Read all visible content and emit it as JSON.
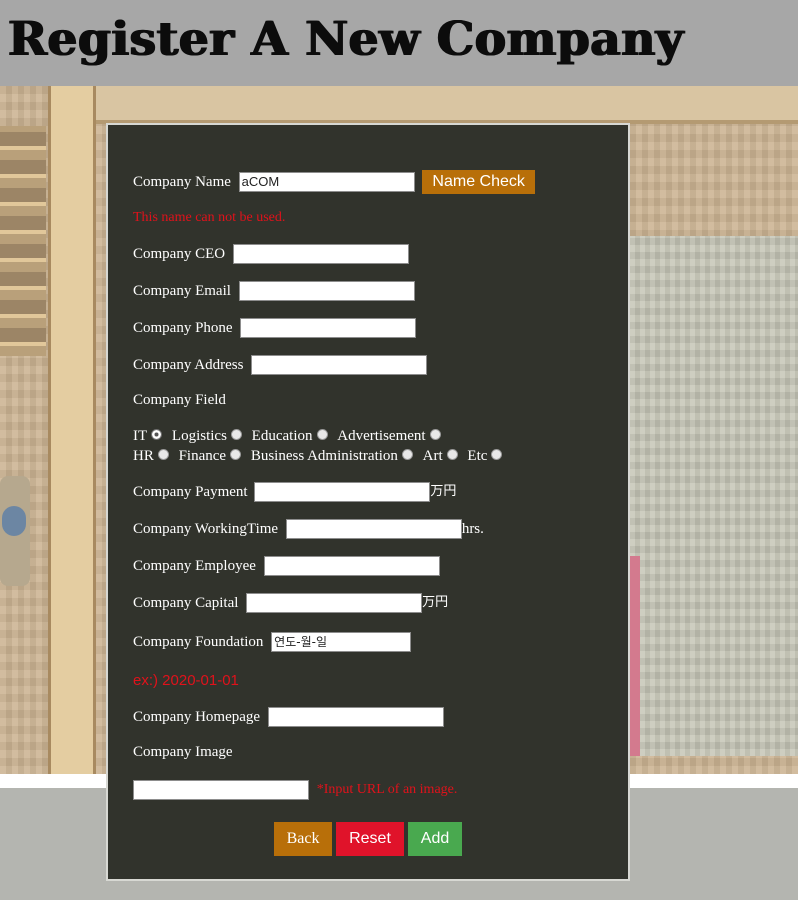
{
  "header": {
    "title": "Register A New Company"
  },
  "form": {
    "company_name": {
      "label": "Company Name",
      "value": "aCOM",
      "check_button": "Name Check"
    },
    "name_error": "This name can not be used.",
    "ceo": {
      "label": "Company CEO",
      "value": ""
    },
    "email": {
      "label": "Company Email",
      "value": ""
    },
    "phone": {
      "label": "Company Phone",
      "value": ""
    },
    "address": {
      "label": "Company Address",
      "value": ""
    },
    "field": {
      "label": "Company Field",
      "options": [
        "IT",
        "Logistics",
        "Education",
        "Advertisement",
        "HR",
        "Finance",
        "Business Administration",
        "Art",
        "Etc"
      ],
      "selected": "IT"
    },
    "payment": {
      "label": "Company Payment",
      "value": "",
      "unit": "万円"
    },
    "working_time": {
      "label": "Company WorkingTime",
      "value": "",
      "unit": "hrs."
    },
    "employee": {
      "label": "Company Employee",
      "value": ""
    },
    "capital": {
      "label": "Company Capital",
      "value": "",
      "unit": "万円"
    },
    "foundation": {
      "label": "Company Foundation",
      "placeholder": "연도-월-일",
      "hint": "ex:) 2020-01-01"
    },
    "homepage": {
      "label": "Company Homepage",
      "value": ""
    },
    "image": {
      "label": "Company Image",
      "value": "",
      "hint": "*Input URL of an image."
    },
    "buttons": {
      "back": "Back",
      "reset": "Reset",
      "add": "Add"
    }
  },
  "colors": {
    "panel_bg": "#31332c",
    "accent_orange": "#b86f09",
    "error_red": "#e0121b",
    "reset_red": "#e0132a",
    "add_green": "#49a94f",
    "header_bg": "#a7a7a7"
  }
}
